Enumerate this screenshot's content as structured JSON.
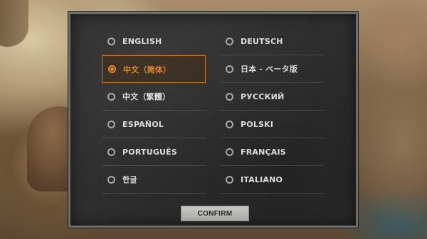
{
  "languages": {
    "left": [
      {
        "label": "ENGLISH",
        "selected": false
      },
      {
        "label": "中文（简体）",
        "selected": true
      },
      {
        "label": "中文（繁體）",
        "selected": false
      },
      {
        "label": "ESPAÑOL",
        "selected": false
      },
      {
        "label": "PORTUGUÊS",
        "selected": false
      },
      {
        "label": "한글",
        "selected": false
      }
    ],
    "right": [
      {
        "label": "DEUTSCH",
        "selected": false
      },
      {
        "label": "日本 - ベータ版",
        "selected": false
      },
      {
        "label": "РУССКИЙ",
        "selected": false
      },
      {
        "label": "POLSKI",
        "selected": false
      },
      {
        "label": "FRANÇAIS",
        "selected": false
      },
      {
        "label": "ITALIANO",
        "selected": false
      }
    ]
  },
  "confirm_label": "CONFIRM",
  "colors": {
    "accent": "#e3882e",
    "panel": "#2f2f2f",
    "text": "#dcdcdc"
  }
}
